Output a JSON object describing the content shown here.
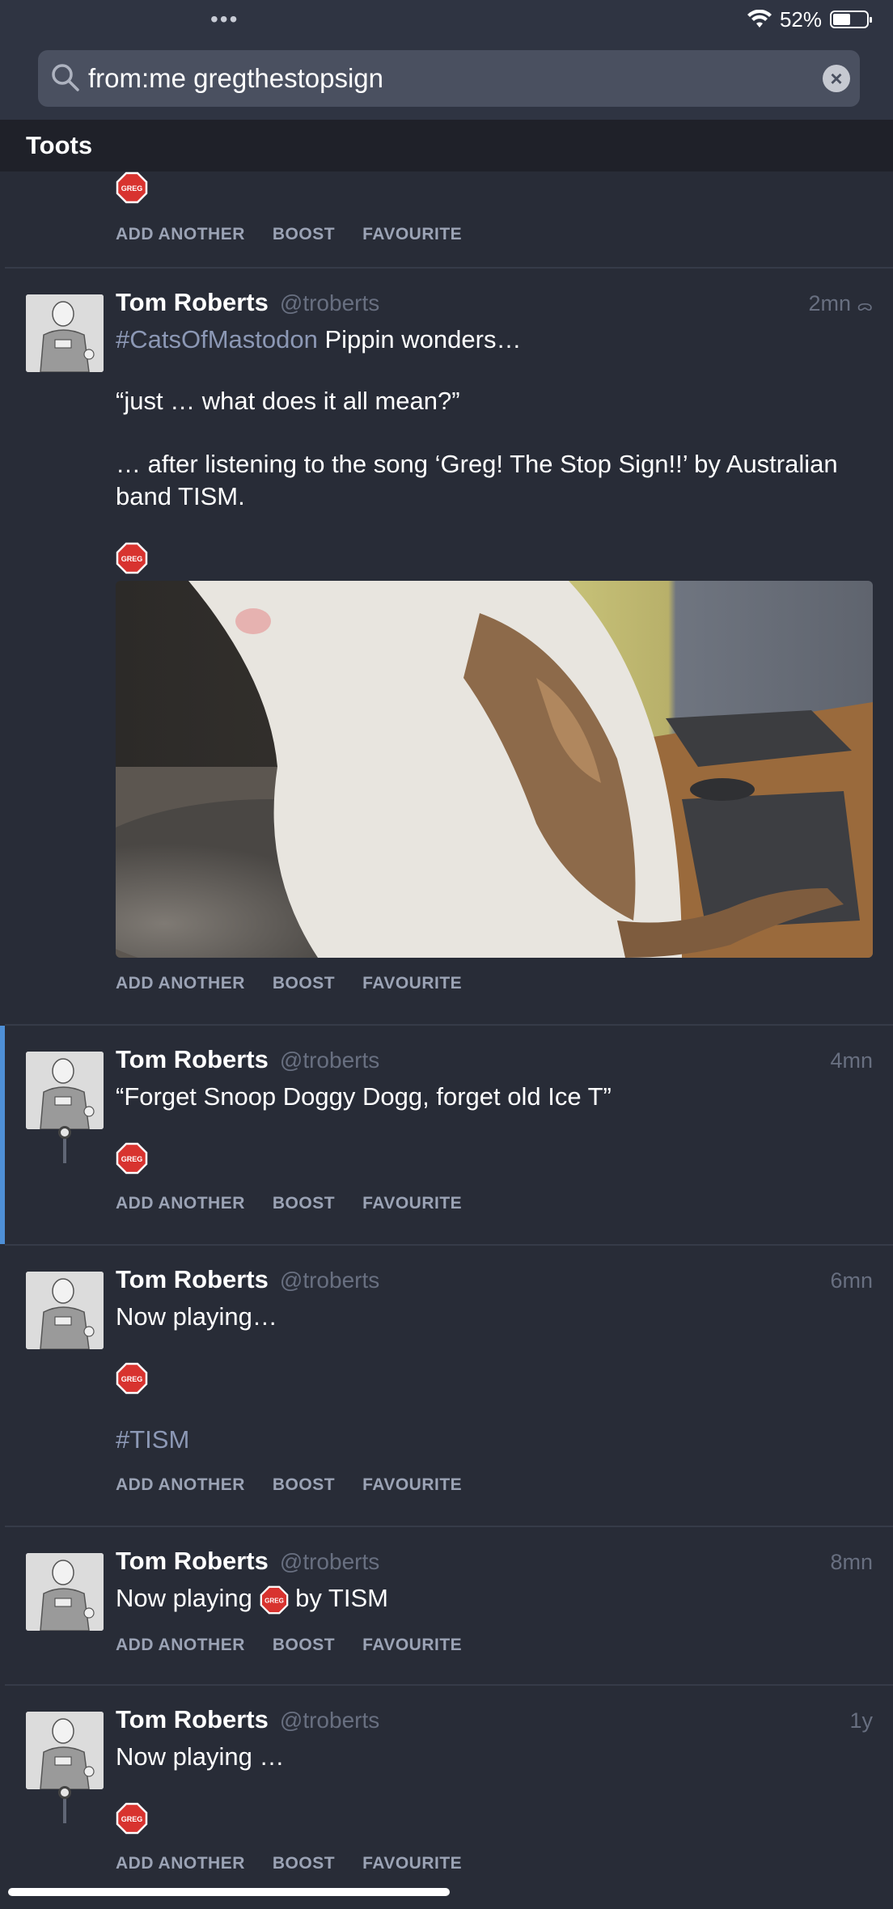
{
  "status_bar": {
    "battery": "52%",
    "battery_level": 0.52
  },
  "search": {
    "query": "from:me gregthestopsign"
  },
  "section": {
    "title": "Toots"
  },
  "actions": {
    "add_another": "ADD ANOTHER",
    "boost": "BOOST",
    "favourite": "FAVOURITE"
  },
  "sticker_label": "GREG",
  "posts": [
    {
      "author": "Tom Roberts",
      "handle": "@troberts",
      "time": "2mn",
      "hashtag": "#CatsOfMastodon",
      "line1": "Pippin wonders…",
      "line2": "“just … what does it all mean?”",
      "line3": "… after listening to the song ‘Greg! The Stop Sign!!’ by Australian band TISM."
    },
    {
      "author": "Tom Roberts",
      "handle": "@troberts",
      "time": "4mn",
      "line1": "“Forget Snoop Doggy Dogg, forget old Ice T”"
    },
    {
      "author": "Tom Roberts",
      "handle": "@troberts",
      "time": "6mn",
      "line1": "Now playing…",
      "hashtag": "#TISM"
    },
    {
      "author": "Tom Roberts",
      "handle": "@troberts",
      "time": "8mn",
      "line1_before": "Now playing",
      "line1_after": "by TISM"
    },
    {
      "author": "Tom Roberts",
      "handle": "@troberts",
      "time": "1y",
      "line1": "Now playing …"
    }
  ]
}
